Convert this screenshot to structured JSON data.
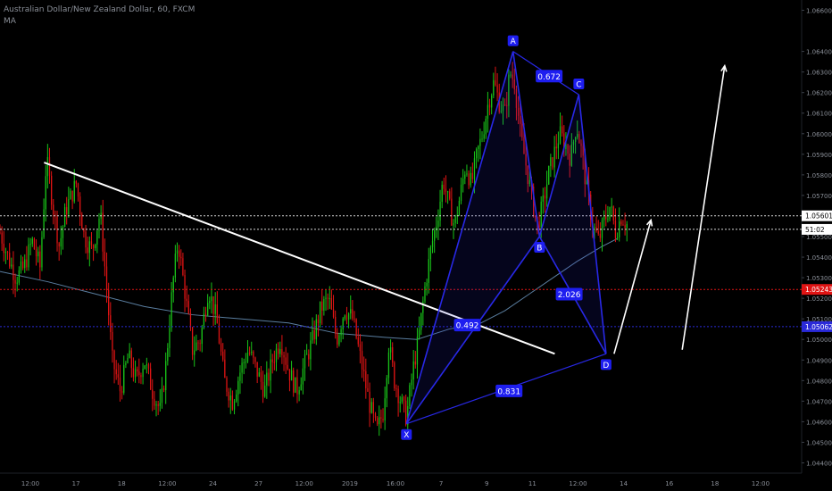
{
  "header": {
    "symbol_line": "Australian Dollar/New Zealand Dollar, 60, FXCM",
    "indicator": "MA"
  },
  "colors": {
    "background": "#000000",
    "candle_up": "#19c319",
    "candle_down": "#e01414",
    "harmonic": "#2828e6",
    "label_box": "#1e1ef0",
    "trendline": "#ffffff",
    "ma_line": "#5a7ea0",
    "red_level": "#e01414",
    "blue_level": "#2a2ad8",
    "white_level": "#d8d8d8",
    "axis_text": "#8a8f98"
  },
  "chart_data": {
    "type": "candlestick",
    "instrument": "AUDNZD",
    "timeframe": "60",
    "ylim": [
      1.0435,
      1.0665
    ],
    "y_ticks": [
      "1.06600",
      "1.06400",
      "1.06300",
      "1.06200",
      "1.06100",
      "1.06000",
      "1.05900",
      "1.05800",
      "1.05700",
      "1.05600",
      "1.05500",
      "1.05400",
      "1.05300",
      "1.05200",
      "1.05100",
      "1.05000",
      "1.04900",
      "1.04800",
      "1.04700",
      "1.04600",
      "1.04500",
      "1.04400"
    ],
    "x_ticks": [
      "12:00",
      "17",
      "18",
      "12:00",
      "24",
      "27",
      "12:00",
      "2019",
      "16:00",
      "7",
      "9",
      "11",
      "12:00",
      "14",
      "16",
      "18",
      "12:00"
    ],
    "price_labels": [
      {
        "text": "1.05601",
        "value": 1.05601,
        "style": "white"
      },
      {
        "text": "51:02",
        "value": 1.05535,
        "style": "white"
      },
      {
        "text": "1.05243",
        "value": 1.05243,
        "style": "red"
      },
      {
        "text": "1.05062",
        "value": 1.05062,
        "style": "blue"
      }
    ],
    "level_lines": [
      {
        "value": 1.05601,
        "style": "white"
      },
      {
        "value": 1.05535,
        "style": "white"
      },
      {
        "value": 1.05243,
        "style": "red"
      },
      {
        "value": 1.05062,
        "style": "blue"
      }
    ],
    "harmonic_points": [
      {
        "label": "X",
        "t": 0.507,
        "price": 1.0459
      },
      {
        "label": "A",
        "t": 0.64,
        "price": 1.064
      },
      {
        "label": "B",
        "t": 0.673,
        "price": 1.055
      },
      {
        "label": "C",
        "t": 0.722,
        "price": 1.0619
      },
      {
        "label": "D",
        "t": 0.756,
        "price": 1.0493
      }
    ],
    "ratios": [
      {
        "text": "0.672",
        "t": 0.685,
        "price": 1.0628
      },
      {
        "text": "0.492",
        "t": 0.583,
        "price": 1.0507
      },
      {
        "text": "2.026",
        "t": 0.71,
        "price": 1.0522
      },
      {
        "text": "0.831",
        "t": 0.635,
        "price": 1.0475
      }
    ],
    "trendline": {
      "t0": 0.055,
      "p0": 1.0586,
      "t1": 0.692,
      "p1": 1.0493
    },
    "projection_arrows": [
      {
        "t0": 0.766,
        "p0": 1.0493,
        "t1": 0.812,
        "p1": 1.0558
      },
      {
        "t0": 0.851,
        "p0": 1.0495,
        "t1": 0.904,
        "p1": 1.0633
      }
    ],
    "ma_series": [
      [
        0.0,
        1.0533
      ],
      [
        0.06,
        1.0528
      ],
      [
        0.12,
        1.0522
      ],
      [
        0.18,
        1.0516
      ],
      [
        0.24,
        1.0512
      ],
      [
        0.3,
        1.051
      ],
      [
        0.36,
        1.0508
      ],
      [
        0.42,
        1.0503
      ],
      [
        0.48,
        1.0501
      ],
      [
        0.52,
        1.05
      ],
      [
        0.56,
        1.0505
      ],
      [
        0.6,
        1.0508
      ],
      [
        0.63,
        1.0514
      ],
      [
        0.66,
        1.0522
      ],
      [
        0.69,
        1.053
      ],
      [
        0.72,
        1.0538
      ],
      [
        0.75,
        1.0545
      ],
      [
        0.77,
        1.0549
      ]
    ],
    "price_path": [
      [
        0.0,
        1.0552
      ],
      [
        0.01,
        1.054
      ],
      [
        0.02,
        1.053
      ],
      [
        0.03,
        1.0535
      ],
      [
        0.04,
        1.0548
      ],
      [
        0.05,
        1.0535
      ],
      [
        0.058,
        1.0588
      ],
      [
        0.066,
        1.0565
      ],
      [
        0.074,
        1.0545
      ],
      [
        0.082,
        1.0563
      ],
      [
        0.095,
        1.0576
      ],
      [
        0.105,
        1.055
      ],
      [
        0.115,
        1.0543
      ],
      [
        0.125,
        1.0562
      ],
      [
        0.133,
        1.0525
      ],
      [
        0.14,
        1.049
      ],
      [
        0.15,
        1.0475
      ],
      [
        0.16,
        1.0492
      ],
      [
        0.17,
        1.048
      ],
      [
        0.18,
        1.049
      ],
      [
        0.19,
        1.0475
      ],
      [
        0.2,
        1.0465
      ],
      [
        0.207,
        1.0488
      ],
      [
        0.215,
        1.0525
      ],
      [
        0.222,
        1.0548
      ],
      [
        0.23,
        1.0525
      ],
      [
        0.24,
        1.0495
      ],
      [
        0.25,
        1.05
      ],
      [
        0.26,
        1.0525
      ],
      [
        0.27,
        1.051
      ],
      [
        0.28,
        1.048
      ],
      [
        0.29,
        1.047
      ],
      [
        0.3,
        1.0485
      ],
      [
        0.31,
        1.0495
      ],
      [
        0.32,
        1.0485
      ],
      [
        0.33,
        1.0475
      ],
      [
        0.34,
        1.049
      ],
      [
        0.35,
        1.05
      ],
      [
        0.36,
        1.0485
      ],
      [
        0.37,
        1.0475
      ],
      [
        0.38,
        1.0488
      ],
      [
        0.39,
        1.05
      ],
      [
        0.4,
        1.0515
      ],
      [
        0.41,
        1.052
      ],
      [
        0.42,
        1.05
      ],
      [
        0.43,
        1.0515
      ],
      [
        0.44,
        1.051
      ],
      [
        0.45,
        1.049
      ],
      [
        0.46,
        1.047
      ],
      [
        0.47,
        1.0455
      ],
      [
        0.478,
        1.0465
      ],
      [
        0.485,
        1.0498
      ],
      [
        0.492,
        1.048
      ],
      [
        0.5,
        1.047
      ],
      [
        0.507,
        1.0462
      ],
      [
        0.515,
        1.0485
      ],
      [
        0.522,
        1.05
      ],
      [
        0.53,
        1.0525
      ],
      [
        0.538,
        1.0545
      ],
      [
        0.546,
        1.056
      ],
      [
        0.553,
        1.0578
      ],
      [
        0.56,
        1.0565
      ],
      [
        0.567,
        1.0555
      ],
      [
        0.574,
        1.057
      ],
      [
        0.581,
        1.0585
      ],
      [
        0.588,
        1.0575
      ],
      [
        0.595,
        1.059
      ],
      [
        0.602,
        1.06
      ],
      [
        0.609,
        1.0615
      ],
      [
        0.616,
        1.0625
      ],
      [
        0.623,
        1.0615
      ],
      [
        0.63,
        1.061
      ],
      [
        0.636,
        1.063
      ],
      [
        0.642,
        1.0625
      ],
      [
        0.649,
        1.06
      ],
      [
        0.656,
        1.0585
      ],
      [
        0.663,
        1.057
      ],
      [
        0.67,
        1.0555
      ],
      [
        0.677,
        1.0565
      ],
      [
        0.684,
        1.058
      ],
      [
        0.691,
        1.059
      ],
      [
        0.698,
        1.06
      ],
      [
        0.705,
        1.0595
      ],
      [
        0.712,
        1.0588
      ],
      [
        0.719,
        1.0605
      ],
      [
        0.726,
        1.059
      ],
      [
        0.733,
        1.057
      ],
      [
        0.74,
        1.0555
      ],
      [
        0.747,
        1.0548
      ],
      [
        0.754,
        1.0558
      ],
      [
        0.761,
        1.0565
      ],
      [
        0.768,
        1.0552
      ],
      [
        0.775,
        1.056
      ],
      [
        0.782,
        1.0556
      ]
    ]
  }
}
